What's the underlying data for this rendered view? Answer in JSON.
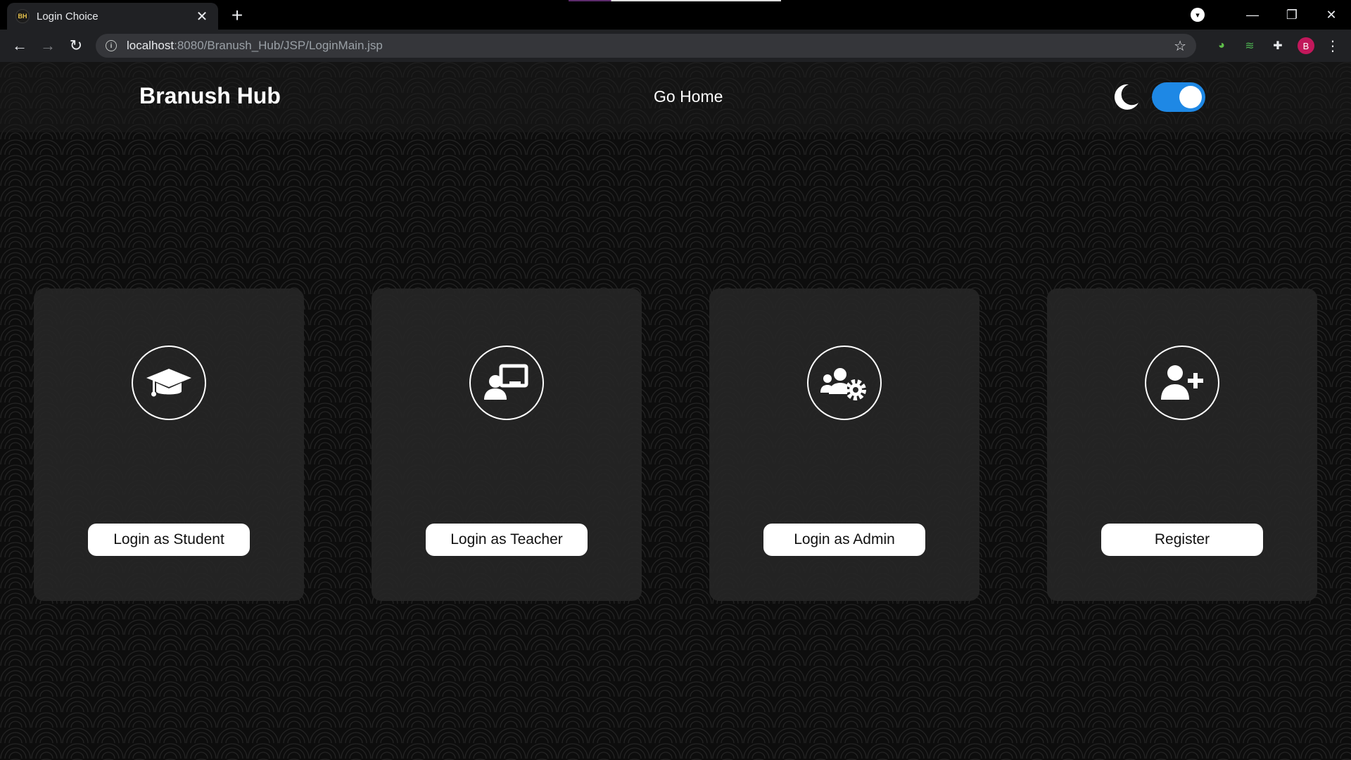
{
  "browser": {
    "tab_title": "Login Choice",
    "favicon_text": "BH",
    "url_host": "localhost",
    "url_path": ":8080/Branush_Hub/JSP/LoginMain.jsp",
    "profile_initial": "B"
  },
  "navbar": {
    "brand": "Branush Hub",
    "go_home": "Go Home",
    "dark_mode_enabled": true,
    "toggle_color": "#1e88e5"
  },
  "cards": [
    {
      "icon": "graduation-cap-icon",
      "button_label": "Login as Student"
    },
    {
      "icon": "chalkboard-teacher-icon",
      "button_label": "Login as Teacher"
    },
    {
      "icon": "users-cog-icon",
      "button_label": "Login as Admin"
    },
    {
      "icon": "user-plus-icon",
      "button_label": "Register"
    }
  ]
}
